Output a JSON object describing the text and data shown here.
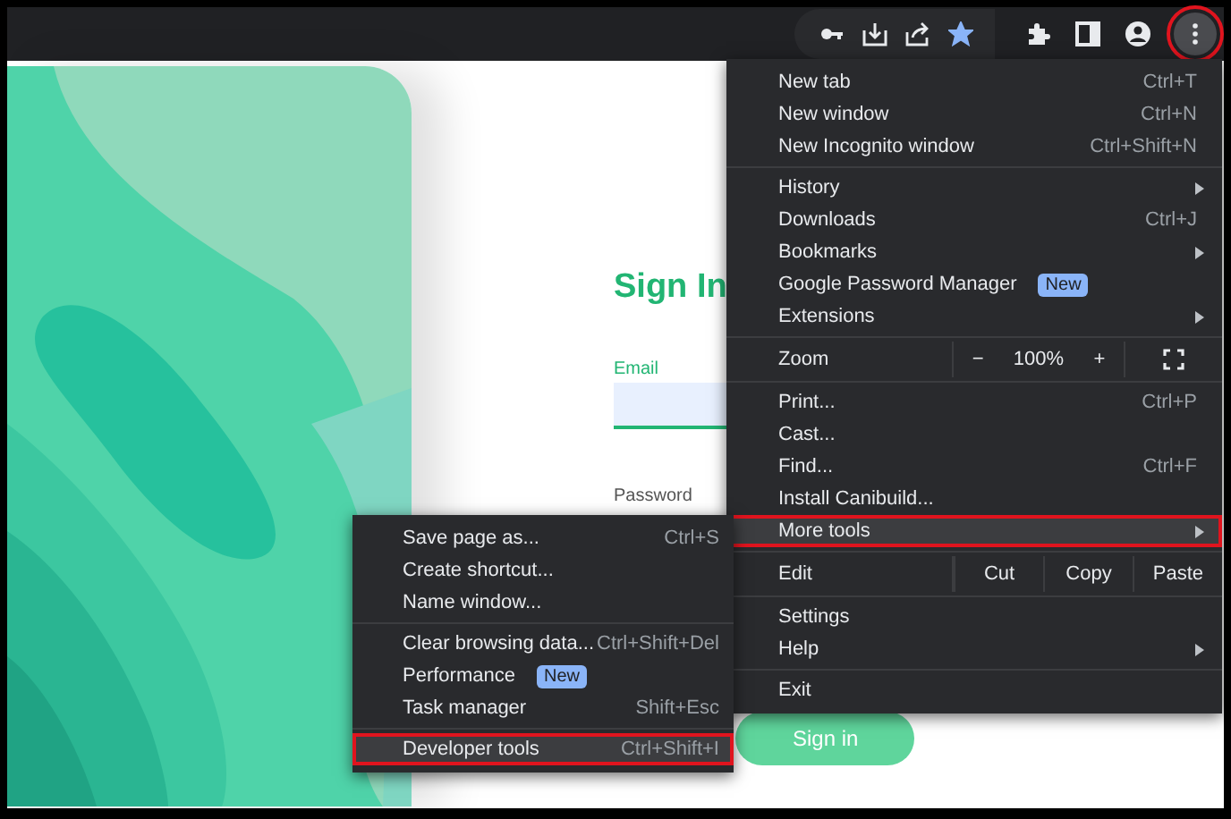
{
  "toolbar": {
    "menu_button": {
      "selected": true
    },
    "bookmark_starred": true
  },
  "page": {
    "heading": "Sign In",
    "email_label": "Email",
    "password_label": "Password",
    "sign_in_button": "Sign in"
  },
  "menu": {
    "sections": [
      [
        {
          "kind": "item",
          "label": "New tab",
          "shortcut": "Ctrl+T",
          "has_submenu": false,
          "selected": false
        },
        {
          "kind": "item",
          "label": "New window",
          "shortcut": "Ctrl+N",
          "has_submenu": false,
          "selected": false
        },
        {
          "kind": "item",
          "label": "New Incognito window",
          "shortcut": "Ctrl+Shift+N",
          "has_submenu": false,
          "selected": false
        }
      ],
      [
        {
          "kind": "item",
          "label": "History",
          "has_submenu": true,
          "selected": false
        },
        {
          "kind": "item",
          "label": "Downloads",
          "shortcut": "Ctrl+J",
          "has_submenu": false,
          "selected": false
        },
        {
          "kind": "item",
          "label": "Bookmarks",
          "has_submenu": true,
          "selected": false
        },
        {
          "kind": "item",
          "label": "Google Password Manager",
          "badge": "New",
          "has_submenu": false,
          "selected": false
        },
        {
          "kind": "item",
          "label": "Extensions",
          "has_submenu": true,
          "selected": false
        }
      ],
      [
        {
          "kind": "zoom",
          "label": "Zoom",
          "minus": "−",
          "value": "100%",
          "plus": "+"
        }
      ],
      [
        {
          "kind": "item",
          "label": "Print...",
          "shortcut": "Ctrl+P",
          "has_submenu": false,
          "selected": false
        },
        {
          "kind": "item",
          "label": "Cast...",
          "has_submenu": false,
          "selected": false
        },
        {
          "kind": "item",
          "label": "Find...",
          "shortcut": "Ctrl+F",
          "has_submenu": false,
          "selected": false
        },
        {
          "kind": "item",
          "label": "Install Canibuild...",
          "has_submenu": false,
          "selected": false
        },
        {
          "kind": "item",
          "label": "More tools",
          "has_submenu": true,
          "selected": true
        }
      ],
      [
        {
          "kind": "edit",
          "label": "Edit",
          "actions": [
            "Cut",
            "Copy",
            "Paste"
          ]
        }
      ],
      [
        {
          "kind": "item",
          "label": "Settings",
          "has_submenu": false,
          "selected": false
        },
        {
          "kind": "item",
          "label": "Help",
          "has_submenu": true,
          "selected": false
        }
      ],
      [
        {
          "kind": "item",
          "label": "Exit",
          "has_submenu": false,
          "selected": false
        }
      ]
    ]
  },
  "more_tools_menu": {
    "sections": [
      [
        {
          "kind": "item",
          "label": "Save page as...",
          "shortcut": "Ctrl+S",
          "selected": false
        },
        {
          "kind": "item",
          "label": "Create shortcut...",
          "selected": false
        },
        {
          "kind": "item",
          "label": "Name window...",
          "selected": false
        }
      ],
      [
        {
          "kind": "item",
          "label": "Clear browsing data...",
          "shortcut": "Ctrl+Shift+Del",
          "selected": false
        },
        {
          "kind": "item",
          "label": "Performance",
          "badge": "New",
          "selected": false
        },
        {
          "kind": "item",
          "label": "Task manager",
          "shortcut": "Shift+Esc",
          "selected": false
        }
      ],
      [
        {
          "kind": "item",
          "label": "Developer tools",
          "shortcut": "Ctrl+Shift+I",
          "selected": true
        }
      ]
    ]
  }
}
